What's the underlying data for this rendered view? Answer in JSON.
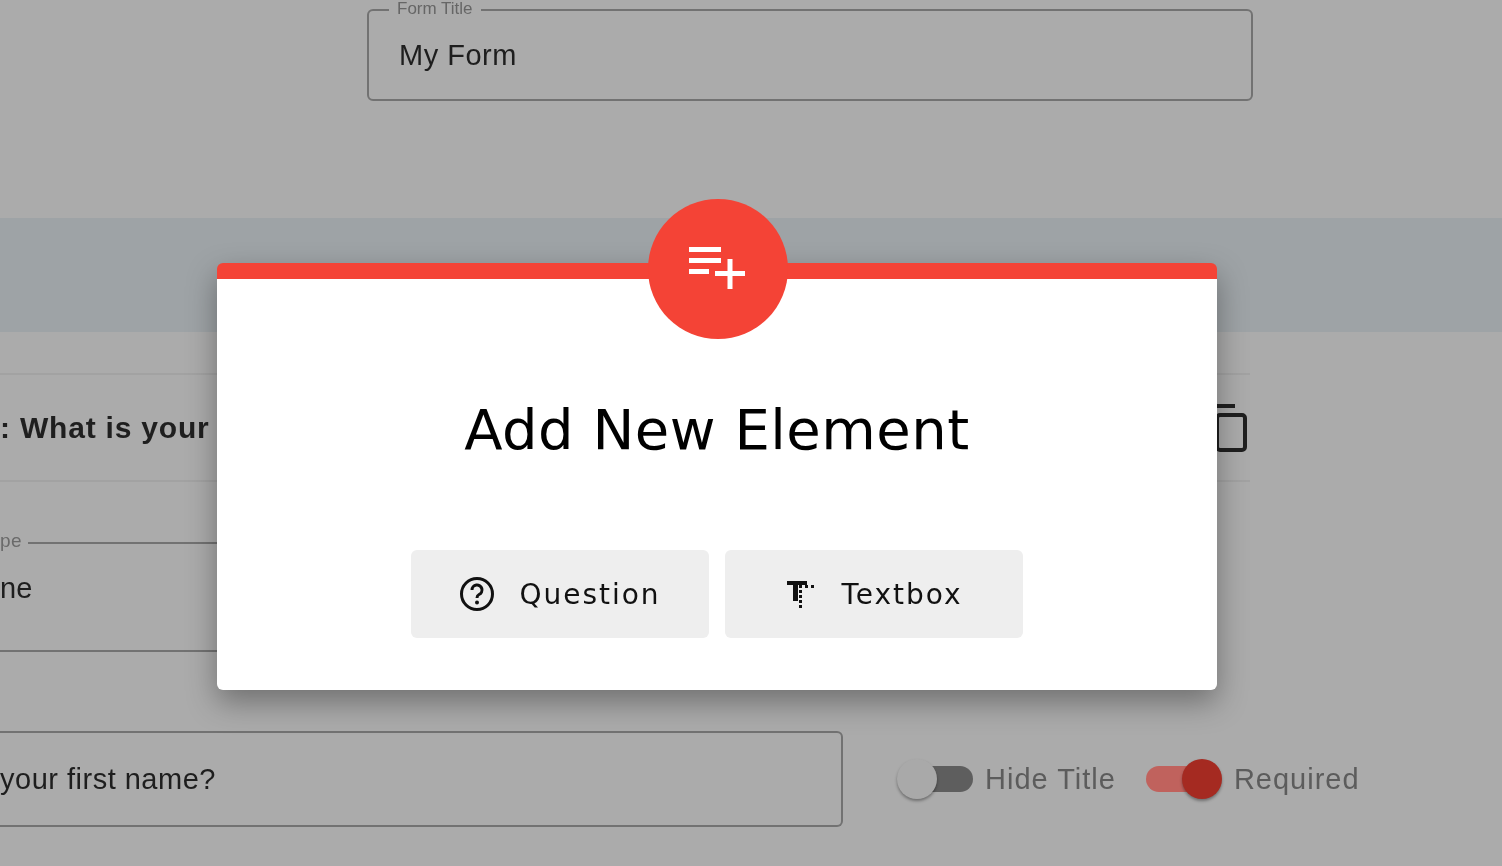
{
  "form_title_field": {
    "label": "Form Title",
    "value": "My Form"
  },
  "question_card": {
    "title": ": What is your",
    "type_field": {
      "label": "pe",
      "value": "ne"
    },
    "question_field": {
      "value": "your first name?"
    },
    "toggles": [
      {
        "label": "Hide Title",
        "on": false
      },
      {
        "label": "Required",
        "on": true
      }
    ]
  },
  "dialog": {
    "title": "Add New Element",
    "options": [
      {
        "kind": "question",
        "label": "Question"
      },
      {
        "kind": "textbox",
        "label": "Textbox"
      }
    ]
  }
}
